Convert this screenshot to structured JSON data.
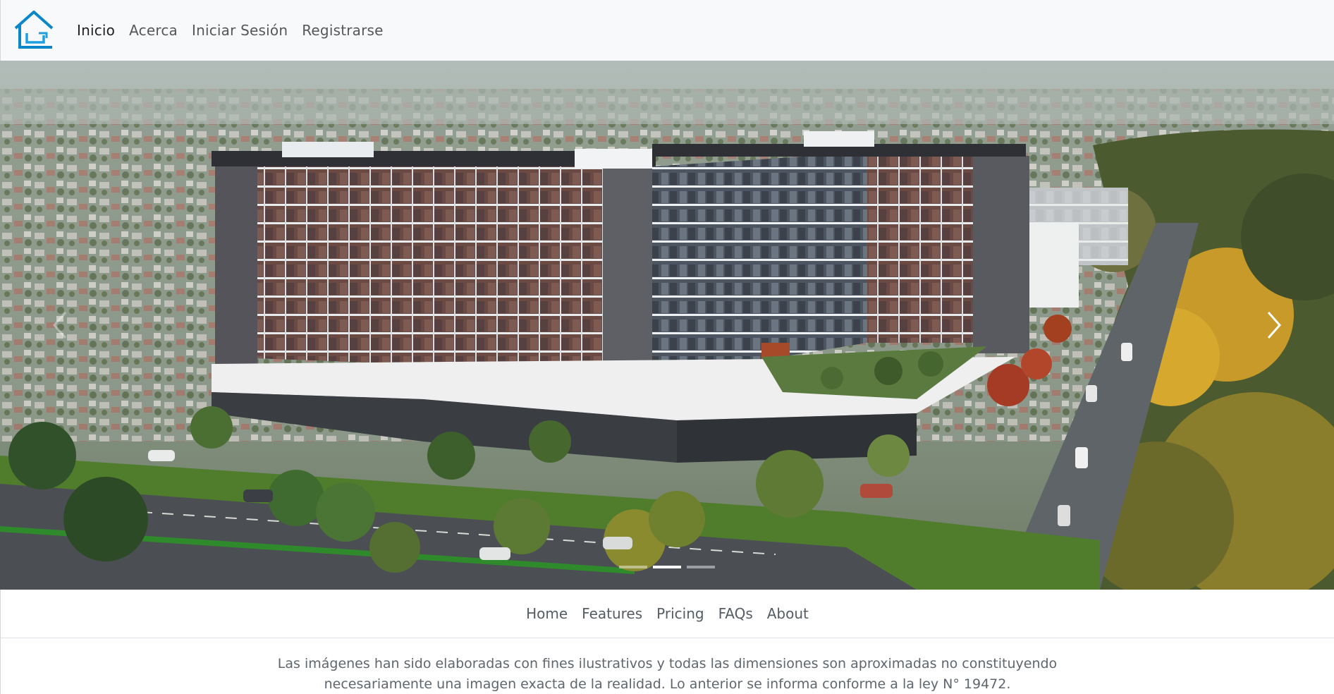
{
  "brand": {
    "logo_icon": "house-outline-icon",
    "accent_color": "#0b86c9"
  },
  "navbar": {
    "links": [
      "Inicio",
      "Acerca",
      "Iniciar Sesión",
      "Registrarse"
    ],
    "active": "Inicio"
  },
  "carousel": {
    "slide_image": "aerial-apartment-complex-render",
    "prev_icon": "chevron-left-icon",
    "next_icon": "chevron-right-icon",
    "slide_count": 3,
    "active_slide": 2
  },
  "footer": {
    "links": [
      "Home",
      "Features",
      "Pricing",
      "FAQs",
      "About"
    ],
    "disclaimer": "Las imágenes han sido elaboradas con fines ilustrativos y todas las dimensiones son aproximadas no constituyendo necesariamente una imagen exacta de la realidad. Lo anterior se informa conforme a la ley N° 19472."
  }
}
